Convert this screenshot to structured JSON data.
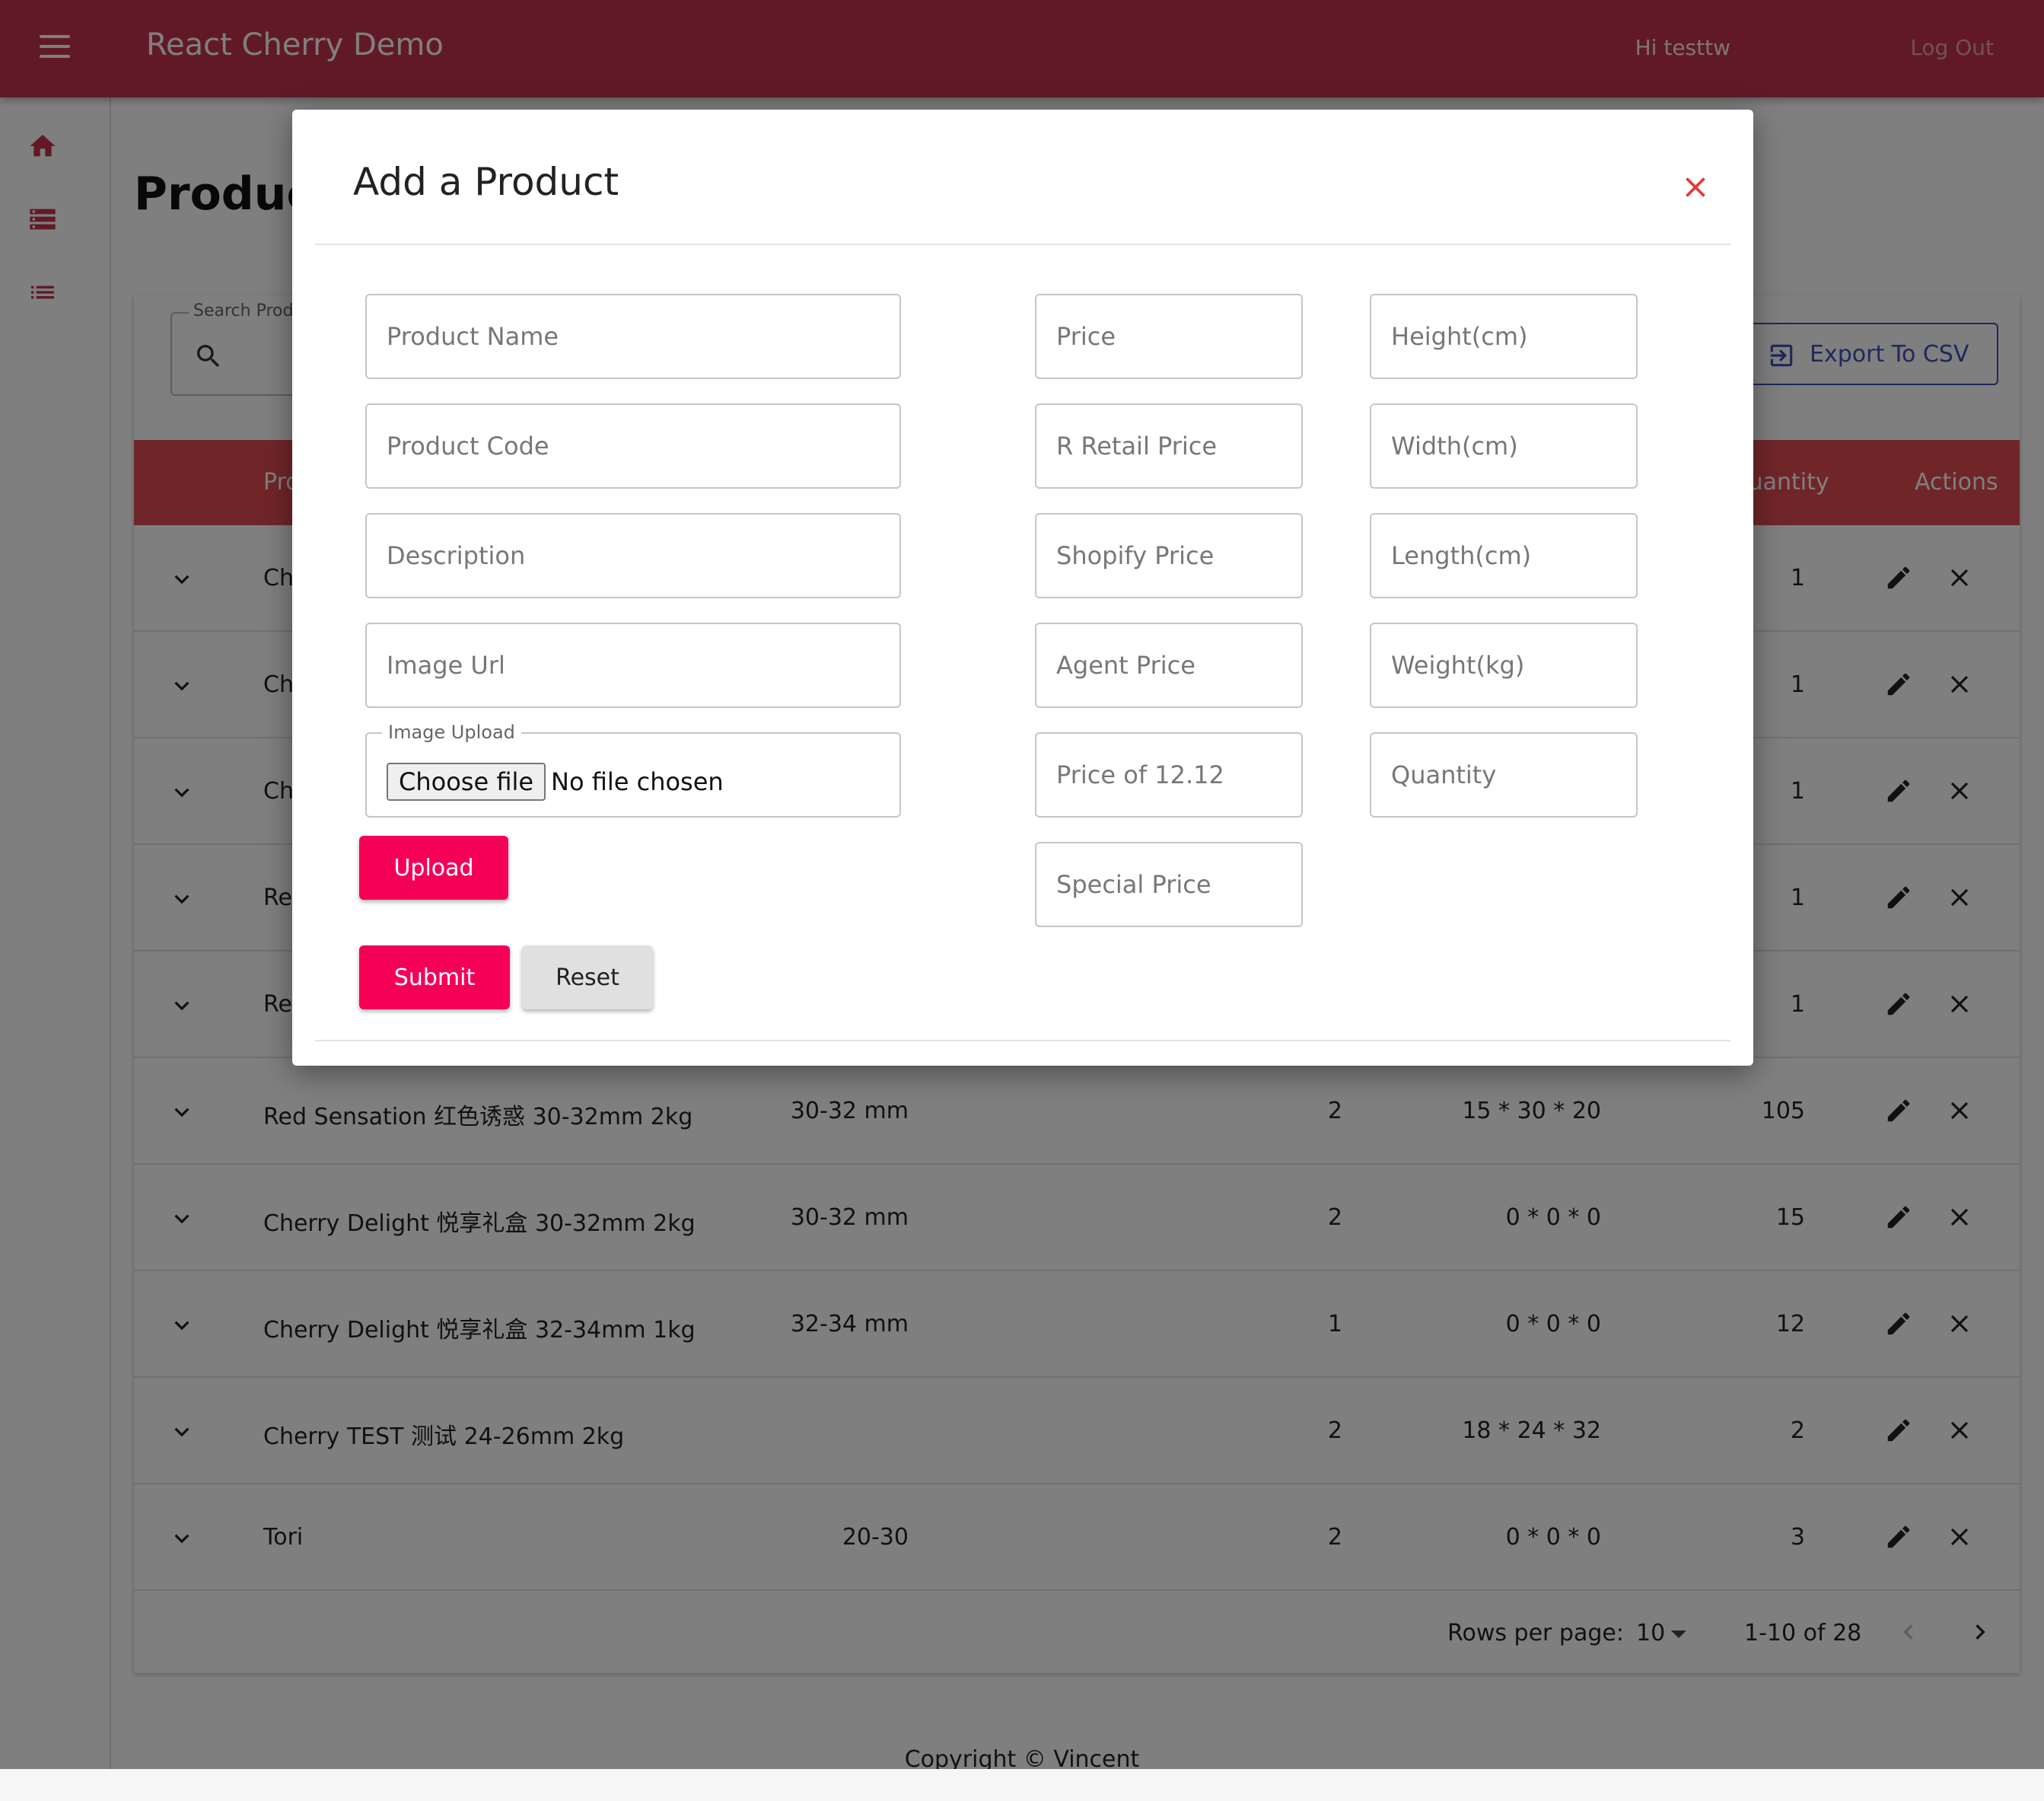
{
  "app": {
    "title": "React Cherry Demo",
    "greeting": "Hi testtw",
    "logout_label": "Log Out",
    "brand_color": "#c2344a",
    "accent_color": "#f50057"
  },
  "sidebar": {
    "items": [
      {
        "icon": "home-icon"
      },
      {
        "icon": "storage-icon"
      },
      {
        "icon": "list-icon"
      }
    ]
  },
  "page": {
    "title": "Products",
    "search_label": "Search Products",
    "export_label": "Export To CSV"
  },
  "table": {
    "headers": {
      "product": "Product",
      "quantity": "Quantity",
      "actions": "Actions"
    },
    "rows": [
      {
        "name": "Ch",
        "size": "",
        "layer": "",
        "dim": "",
        "qty": "1"
      },
      {
        "name": "Ch",
        "size": "",
        "layer": "",
        "dim": "",
        "qty": "1"
      },
      {
        "name": "Ch",
        "size": "",
        "layer": "",
        "dim": "",
        "qty": "1"
      },
      {
        "name": "Re",
        "size": "",
        "layer": "",
        "dim": "",
        "qty": "1"
      },
      {
        "name": "Re",
        "size": "",
        "layer": "",
        "dim": "",
        "qty": "1"
      },
      {
        "name": "Red Sensation 红色诱惑 30-32mm 2kg",
        "size": "30-32 mm",
        "layer": "2",
        "dim": "15 * 30 * 20",
        "qty": "105"
      },
      {
        "name": "Cherry Delight 悦享礼盒 30-32mm 2kg",
        "size": "30-32 mm",
        "layer": "2",
        "dim": "0 * 0 * 0",
        "qty": "15"
      },
      {
        "name": "Cherry Delight 悦享礼盒 32-34mm 1kg",
        "size": "32-34 mm",
        "layer": "1",
        "dim": "0 * 0 * 0",
        "qty": "12"
      },
      {
        "name": "Cherry TEST 测试 24-26mm 2kg",
        "size": "",
        "layer": "2",
        "dim": "18 * 24 * 32",
        "qty": "2"
      },
      {
        "name": "Tori",
        "size": "20-30",
        "layer": "2",
        "dim": "0 * 0 * 0",
        "qty": "3"
      }
    ]
  },
  "pagination": {
    "rows_per_page_label": "Rows per page:",
    "rows_per_page": "10",
    "range": "1-10 of 28"
  },
  "footer": {
    "copyright": "Copyright © Vincent"
  },
  "modal": {
    "title": "Add a Product",
    "fields": {
      "product_name": "Product Name",
      "product_code": "Product Code",
      "description": "Description",
      "image_url": "Image Url",
      "price": "Price",
      "r_retail_price": "R Retail Price",
      "shopify_price": "Shopify Price",
      "agent_price": "Agent Price",
      "price_12_12": "Price of 12.12",
      "special_price": "Special Price",
      "height": "Height(cm)",
      "width": "Width(cm)",
      "length": "Length(cm)",
      "weight": "Weight(kg)",
      "quantity": "Quantity"
    },
    "image_upload": {
      "label": "Image Upload",
      "choose_label": "Choose file",
      "status": "No file chosen"
    },
    "upload_label": "Upload",
    "submit_label": "Submit",
    "reset_label": "Reset"
  }
}
